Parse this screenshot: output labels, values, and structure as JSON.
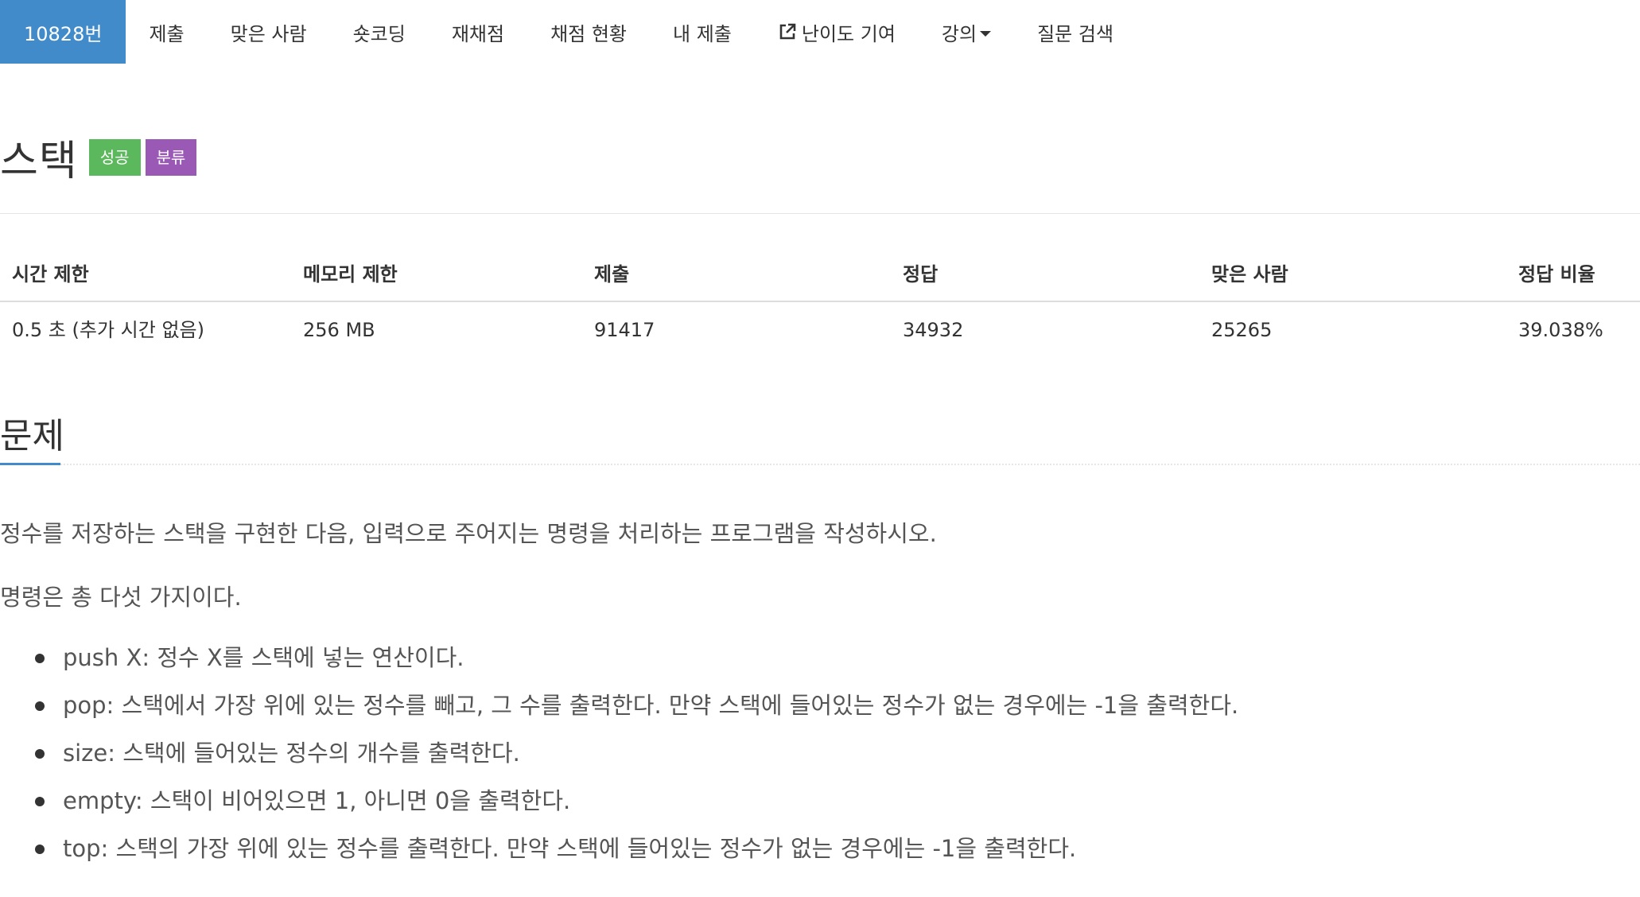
{
  "nav": {
    "items": [
      {
        "label": "10828번"
      },
      {
        "label": "제출"
      },
      {
        "label": "맞은 사람"
      },
      {
        "label": "숏코딩"
      },
      {
        "label": "재채점"
      },
      {
        "label": "채점 현황"
      },
      {
        "label": "내 제출"
      },
      {
        "label": "난이도 기여",
        "icon": "external-link-icon"
      },
      {
        "label": "강의",
        "icon": "caret-down-icon"
      },
      {
        "label": "질문 검색"
      }
    ],
    "active_index": 0,
    "active_color": "#428bca"
  },
  "problem": {
    "title": "스택",
    "badges": [
      {
        "label": "성공",
        "color": "#5cb85c"
      },
      {
        "label": "분류",
        "color": "#9b59b6"
      }
    ]
  },
  "info_table": {
    "headers": [
      "시간 제한",
      "메모리 제한",
      "제출",
      "정답",
      "맞은 사람",
      "정답 비율"
    ],
    "values": [
      "0.5 초 (추가 시간 없음)",
      "256 MB",
      "91417",
      "34932",
      "25265",
      "39.038%"
    ]
  },
  "section": {
    "title": "문제",
    "paragraphs": [
      "정수를 저장하는 스택을 구현한 다음, 입력으로 주어지는 명령을 처리하는 프로그램을 작성하시오.",
      "명령은 총 다섯 가지이다."
    ],
    "bullets": [
      "push X: 정수 X를 스택에 넣는 연산이다.",
      "pop: 스택에서 가장 위에 있는 정수를 빼고, 그 수를 출력한다. 만약 스택에 들어있는 정수가 없는 경우에는 -1을 출력한다.",
      "size: 스택에 들어있는 정수의 개수를 출력한다.",
      "empty: 스택이 비어있으면 1, 아니면 0을 출력한다.",
      "top: 스택의 가장 위에 있는 정수를 출력한다. 만약 스택에 들어있는 정수가 없는 경우에는 -1을 출력한다."
    ]
  }
}
